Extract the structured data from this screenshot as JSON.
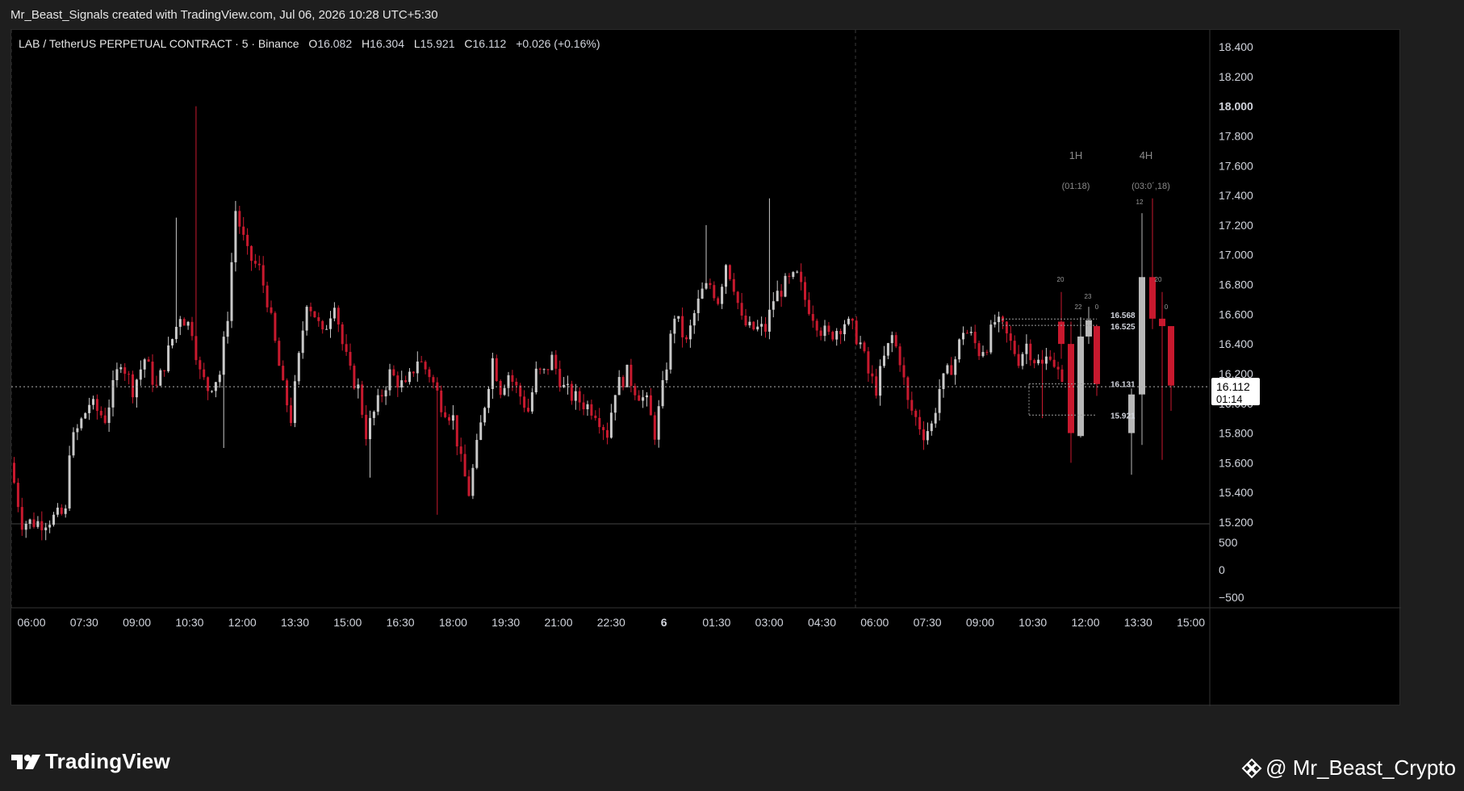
{
  "topbar": {
    "credit": "Mr_Beast_Signals created with TradingView.com, Jul 06, 2026 10:28 UTC+5:30"
  },
  "legend": {
    "symbol": "LAB / TetherUS PERPETUAL CONTRACT · 5 · Binance",
    "o_label": "O",
    "o": "16.082",
    "h_label": "H",
    "h": "16.304",
    "l_label": "L",
    "l": "15.921",
    "c_label": "C",
    "c": "16.112",
    "change": "+0.026 (+0.16%)"
  },
  "footer": {
    "brand": "TradingView",
    "handle": "@ Mr_Beast_Crypto"
  },
  "colors": {
    "up": "#c9c9c9",
    "down": "#c8192e",
    "bg": "#000000",
    "text": "#d1d4dc"
  },
  "chart_data": {
    "type": "candlestick",
    "symbol": "LAB / TetherUS PERPETUAL CONTRACT",
    "interval": "5",
    "exchange": "Binance",
    "price_axis": {
      "ticks": [
        "15.200",
        "15.400",
        "15.600",
        "15.800",
        "16.000",
        "16.200",
        "16.400",
        "16.600",
        "16.800",
        "17.000",
        "17.200",
        "17.400",
        "17.600",
        "17.800",
        "18.000",
        "18.200",
        "18.400"
      ],
      "bold_tick": "18.000",
      "range": [
        15.2,
        18.5
      ]
    },
    "last_price": {
      "value": "16.112",
      "countdown": "01:14"
    },
    "volume_axis": {
      "ticks": [
        "500",
        "0",
        "−500"
      ],
      "range": [
        -650,
        650
      ]
    },
    "time_axis": {
      "labels": [
        "06:00",
        "07:30",
        "09:00",
        "10:30",
        "12:00",
        "13:30",
        "15:00",
        "16:30",
        "18:00",
        "19:30",
        "21:00",
        "22:30",
        "6",
        "01:30",
        "03:00",
        "04:30",
        "06:00",
        "07:30",
        "09:00",
        "10:30",
        "12:00",
        "13:30",
        "15:00"
      ],
      "day_separators": [
        "00:00",
        "06:00"
      ]
    },
    "crosshair_price": 16.112,
    "path": [
      [
        0,
        15.6
      ],
      [
        3,
        15.2
      ],
      [
        8,
        15.2
      ],
      [
        14,
        15.26
      ],
      [
        15,
        15.7
      ],
      [
        20,
        16.0
      ],
      [
        24,
        15.9
      ],
      [
        28,
        16.3
      ],
      [
        31,
        16.1
      ],
      [
        34,
        16.3
      ],
      [
        37,
        16.1
      ],
      [
        40,
        16.35
      ],
      [
        43,
        16.6
      ],
      [
        46,
        16.5
      ],
      [
        48,
        16.2
      ],
      [
        50,
        16.1
      ],
      [
        53,
        16.2
      ],
      [
        55,
        16.6
      ],
      [
        57,
        17.3
      ],
      [
        60,
        17.0
      ],
      [
        63,
        16.9
      ],
      [
        65,
        16.7
      ],
      [
        67,
        16.4
      ],
      [
        69,
        16.1
      ],
      [
        71,
        15.9
      ],
      [
        73,
        16.3
      ],
      [
        75,
        16.7
      ],
      [
        77,
        16.6
      ],
      [
        79,
        16.45
      ],
      [
        82,
        16.7
      ],
      [
        84,
        16.4
      ],
      [
        86,
        16.2
      ],
      [
        88,
        16.1
      ],
      [
        90,
        15.8
      ],
      [
        93,
        16.0
      ],
      [
        96,
        16.2
      ],
      [
        100,
        16.1
      ],
      [
        103,
        16.3
      ],
      [
        106,
        16.2
      ],
      [
        109,
        16.0
      ],
      [
        112,
        15.9
      ],
      [
        114,
        15.6
      ],
      [
        116,
        15.4
      ],
      [
        118,
        15.7
      ],
      [
        120,
        16.0
      ],
      [
        122,
        16.3
      ],
      [
        124,
        16.1
      ],
      [
        126,
        16.2
      ],
      [
        128,
        16.1
      ],
      [
        131,
        15.95
      ],
      [
        133,
        16.2
      ],
      [
        135,
        16.2
      ],
      [
        137,
        16.3
      ],
      [
        140,
        16.1
      ],
      [
        142,
        16.05
      ],
      [
        145,
        16.0
      ],
      [
        148,
        15.95
      ],
      [
        151,
        15.8
      ],
      [
        153,
        16.1
      ],
      [
        156,
        16.2
      ],
      [
        158,
        16.1
      ],
      [
        161,
        16.0
      ],
      [
        163,
        15.8
      ],
      [
        165,
        16.1
      ],
      [
        168,
        16.6
      ],
      [
        171,
        16.4
      ],
      [
        173,
        16.6
      ],
      [
        175,
        16.75
      ],
      [
        177,
        16.8
      ],
      [
        179,
        16.7
      ],
      [
        181,
        16.95
      ],
      [
        183,
        16.8
      ],
      [
        185,
        16.55
      ],
      [
        187,
        16.5
      ],
      [
        189,
        16.5
      ],
      [
        191,
        16.5
      ],
      [
        193,
        16.7
      ],
      [
        196,
        16.8
      ],
      [
        199,
        16.85
      ],
      [
        201,
        16.7
      ],
      [
        203,
        16.6
      ],
      [
        205,
        16.5
      ],
      [
        207,
        16.45
      ],
      [
        209,
        16.5
      ],
      [
        211,
        16.55
      ],
      [
        213,
        16.5
      ],
      [
        215,
        16.4
      ],
      [
        217,
        16.2
      ],
      [
        219,
        16.1
      ],
      [
        221,
        16.3
      ],
      [
        223,
        16.45
      ],
      [
        225,
        16.3
      ],
      [
        227,
        16.0
      ],
      [
        229,
        15.9
      ],
      [
        231,
        15.8
      ],
      [
        233,
        15.85
      ],
      [
        235,
        16.1
      ],
      [
        237,
        16.2
      ],
      [
        239,
        16.3
      ],
      [
        241,
        16.5
      ],
      [
        243,
        16.45
      ],
      [
        245,
        16.35
      ],
      [
        247,
        16.4
      ],
      [
        249,
        16.55
      ],
      [
        251,
        16.5
      ],
      [
        253,
        16.4
      ],
      [
        255,
        16.3
      ],
      [
        257,
        16.4
      ],
      [
        259,
        16.3
      ],
      [
        261,
        16.25
      ],
      [
        263,
        16.35
      ],
      [
        265,
        16.2
      ],
      [
        266,
        16.1
      ]
    ],
    "spikes": [
      [
        46,
        18.0,
        "high"
      ],
      [
        41,
        17.25,
        "high"
      ],
      [
        175,
        17.2,
        "high"
      ],
      [
        191,
        17.38,
        "high"
      ],
      [
        107,
        15.25,
        "low"
      ],
      [
        53,
        15.7,
        "low"
      ],
      [
        90,
        15.5,
        "low"
      ],
      [
        260,
        15.9,
        "low"
      ]
    ],
    "htf": {
      "labels": [
        "1H",
        "4H"
      ],
      "timers": [
        "(01:18)",
        "(03:0´,18)"
      ],
      "candles_1h": [
        {
          "open": 16.55,
          "close": 16.4,
          "high": 16.75,
          "low": 16.3
        },
        {
          "open": 16.4,
          "close": 15.8,
          "high": 16.55,
          "low": 15.6
        },
        {
          "open": 15.78,
          "close": 16.45,
          "high": 16.58,
          "low": 15.77
        },
        {
          "open": 16.45,
          "close": 16.56,
          "high": 16.65,
          "low": 16.4
        },
        {
          "open": 16.52,
          "close": 16.13,
          "high": 16.53,
          "low": 16.05
        }
      ],
      "candles_4h": [
        {
          "open": 15.8,
          "close": 16.06,
          "high": 16.1,
          "low": 15.52
        },
        {
          "open": 16.06,
          "close": 16.85,
          "high": 17.28,
          "low": 15.72
        },
        {
          "open": 16.85,
          "close": 16.57,
          "high": 17.38,
          "low": 16.5
        },
        {
          "open": 16.57,
          "close": 16.52,
          "high": 16.75,
          "low": 15.62
        },
        {
          "open": 16.52,
          "close": 16.12,
          "high": 16.52,
          "low": 15.95
        }
      ],
      "counts_1h": [
        "20",
        "22",
        "23",
        "0"
      ],
      "counts_4h": [
        "12",
        "20",
        "0"
      ],
      "levels": [
        {
          "label": "16.568",
          "value": 16.568
        },
        {
          "label": "16.525",
          "value": 16.525
        },
        {
          "label": "16.131",
          "value": 16.131
        },
        {
          "label": "15.921",
          "value": 15.921
        }
      ]
    }
  }
}
